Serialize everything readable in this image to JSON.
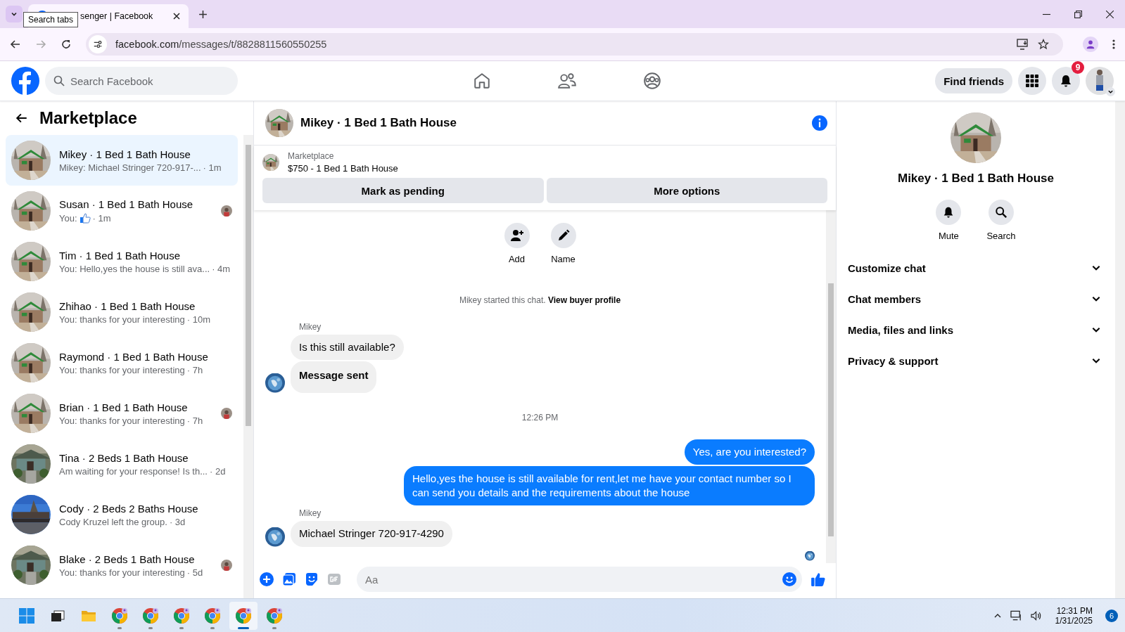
{
  "browser": {
    "tooltip": "Search tabs",
    "tab_title": "senger | Facebook",
    "url_host": "facebook.com",
    "url_path": "/messages/t/8828811560550255"
  },
  "header": {
    "search_placeholder": "Search Facebook",
    "find_friends": "Find friends",
    "notification_count": "9"
  },
  "sidebar": {
    "title": "Marketplace",
    "conversations": [
      {
        "name": "Mikey · 1 Bed 1 Bath House",
        "preview": "Mikey: Michael Stringer 720-917-...",
        "time": "· 1m",
        "selected": true,
        "seen": false,
        "like": false
      },
      {
        "name": "Susan · 1 Bed 1 Bath House",
        "preview": "You:",
        "time": "· 1m",
        "selected": false,
        "seen": true,
        "like": true
      },
      {
        "name": "Tim · 1 Bed 1 Bath House",
        "preview": "You: Hello,yes the house is still ava...",
        "time": "· 4m",
        "selected": false,
        "seen": false,
        "like": false
      },
      {
        "name": "Zhihao · 1 Bed 1 Bath House",
        "preview": "You: thanks for your interesting",
        "time": "· 10m",
        "selected": false,
        "seen": false,
        "like": false
      },
      {
        "name": "Raymond · 1 Bed 1 Bath House",
        "preview": "You: thanks for your interesting",
        "time": "· 7h",
        "selected": false,
        "seen": false,
        "like": false
      },
      {
        "name": "Brian · 1 Bed 1 Bath House",
        "preview": "You: thanks for your interesting",
        "time": "· 7h",
        "selected": false,
        "seen": true,
        "like": false
      },
      {
        "name": "Tina · 2 Beds 1 Bath House",
        "preview": "Am waiting for your response! Is th...",
        "time": "· 2d",
        "selected": false,
        "seen": false,
        "like": false
      },
      {
        "name": "Cody · 2 Beds 2 Baths House",
        "preview": "Cody Kruzel left the group.",
        "time": "· 3d",
        "selected": false,
        "seen": false,
        "like": false
      },
      {
        "name": "Blake · 2 Beds 1 Bath House",
        "preview": "You: thanks for your interesting",
        "time": "· 5d",
        "selected": false,
        "seen": true,
        "like": false
      }
    ]
  },
  "chat": {
    "title": "Mikey · 1 Bed 1 Bath House",
    "listing": {
      "label": "Marketplace",
      "title": "$750 - 1 Bed 1 Bath House"
    },
    "actions": [
      "Mark as pending",
      "More options"
    ],
    "quick_actions": [
      {
        "kind": "add",
        "label": "Add"
      },
      {
        "kind": "name",
        "label": "Name"
      }
    ],
    "notice": {
      "text": "Mikey started this chat.",
      "link": "View buyer profile"
    },
    "messages": [
      {
        "kind": "sender",
        "text": "Mikey"
      },
      {
        "kind": "in",
        "text": "Is this still available?",
        "bold": false,
        "avatar": false
      },
      {
        "kind": "in",
        "text": "Message sent",
        "bold": true,
        "avatar": true
      },
      {
        "kind": "time",
        "text": "12:26 PM"
      },
      {
        "kind": "out",
        "text": "Yes, are you interested?"
      },
      {
        "kind": "out",
        "text": "Hello,yes the house is still available for rent,let me have your contact number   so I can send you details and the requirements about the house"
      },
      {
        "kind": "sender",
        "text": "Mikey"
      },
      {
        "kind": "in",
        "text": "Michael Stringer 720-917-4290",
        "bold": false,
        "avatar": true
      }
    ],
    "seen": true,
    "composer_placeholder": "Aa"
  },
  "details": {
    "title": "Mikey · 1 Bed 1 Bath House",
    "buttons": [
      {
        "kind": "mute",
        "label": "Mute"
      },
      {
        "kind": "search",
        "label": "Search"
      }
    ],
    "sections": [
      {
        "label": "Customize chat",
        "expanded": false
      },
      {
        "label": "Chat members",
        "expanded": false
      },
      {
        "label": "Media, files and links",
        "expanded": false
      },
      {
        "label": "Privacy & support",
        "expanded": false
      }
    ]
  },
  "taskbar": {
    "apps": [
      {
        "kind": "start",
        "selected": false
      },
      {
        "kind": "taskview",
        "selected": false
      },
      {
        "kind": "files",
        "selected": false
      },
      {
        "kind": "chrome",
        "selected": false
      },
      {
        "kind": "chrome",
        "selected": false
      },
      {
        "kind": "chrome",
        "selected": false
      },
      {
        "kind": "chrome",
        "selected": false
      },
      {
        "kind": "chrome",
        "selected": true
      },
      {
        "kind": "chrome",
        "selected": false
      }
    ],
    "time": "12:31 PM",
    "date": "1/31/2025",
    "badge": "6"
  }
}
